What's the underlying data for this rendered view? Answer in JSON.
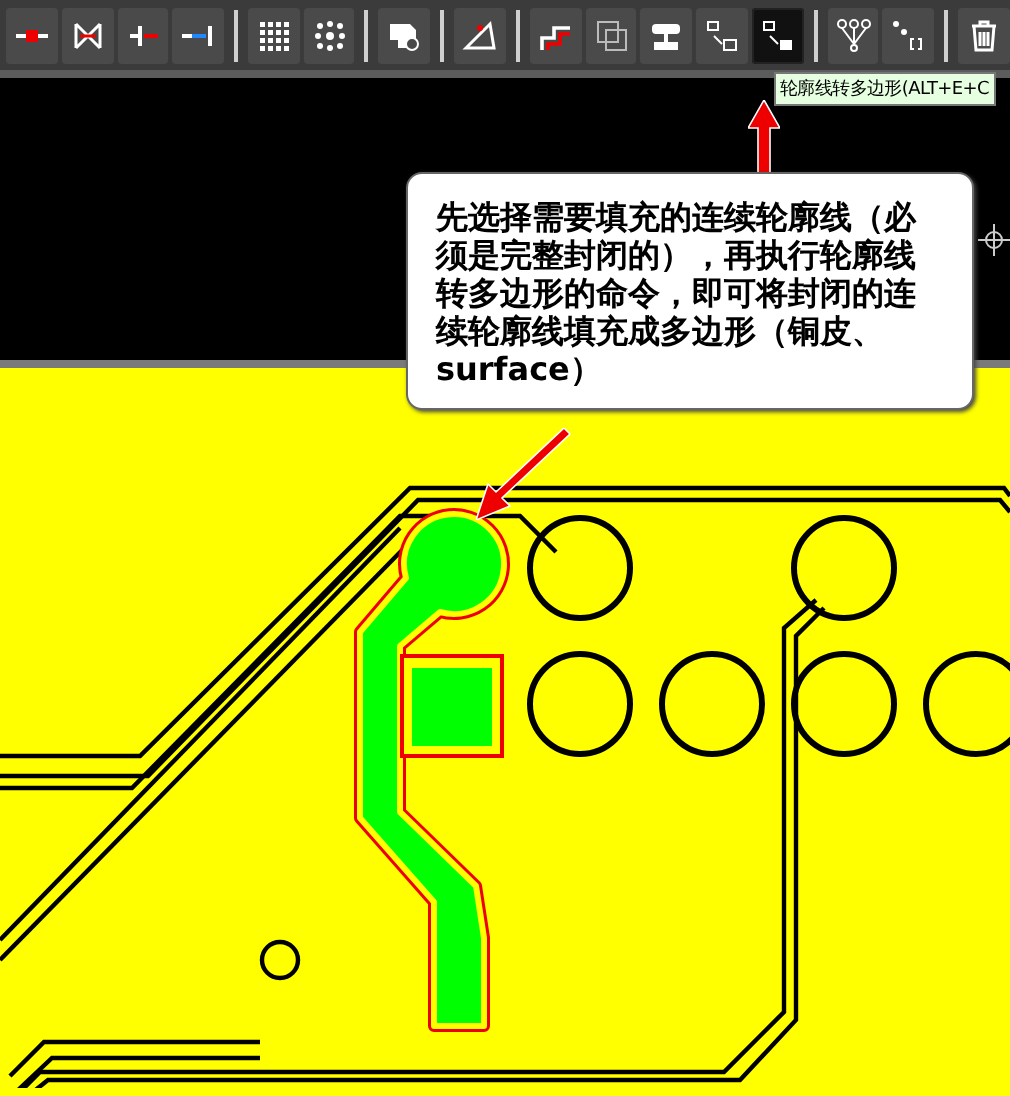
{
  "toolbar": {
    "groups": [
      [
        {
          "selected": false
        },
        {
          "selected": false
        },
        {
          "selected": false
        },
        {
          "selected": false
        }
      ],
      [
        {
          "selected": false
        },
        {
          "selected": false
        }
      ],
      [
        {
          "selected": false
        }
      ],
      [
        {
          "selected": false
        }
      ],
      [
        {
          "selected": false
        },
        {
          "selected": false
        },
        {
          "selected": false
        },
        {
          "selected": false
        },
        {
          "selected": true
        }
      ],
      [
        {
          "selected": false
        },
        {
          "selected": false
        }
      ],
      [
        {
          "selected": false
        }
      ]
    ]
  },
  "tooltip": {
    "text": "轮廓线转多边形(ALT+E+C"
  },
  "callout": {
    "text": "先选择需要填充的连续轮廓线（必须是完整封闭的），再执行轮廓线转多边形的命令，即可将封闭的连续轮廓线填充成多边形（铜皮、surface）"
  }
}
